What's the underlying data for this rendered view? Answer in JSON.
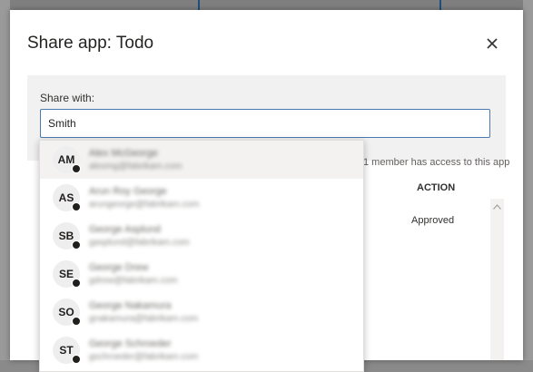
{
  "dialog": {
    "title": "Share app: Todo",
    "close_icon": "close-icon"
  },
  "share": {
    "label": "Share with:",
    "value": "Smith",
    "access_note": "1 member has access to this app"
  },
  "table": {
    "action_header": "ACTION",
    "rows": [
      {
        "action": "Approved"
      }
    ]
  },
  "suggestions": [
    {
      "initials": "AM",
      "name": "Alex McGeorge",
      "email": "alexmg@fabrikam.com"
    },
    {
      "initials": "AS",
      "name": "Arun Roy George",
      "email": "arungeorge@fabrikam.com"
    },
    {
      "initials": "SB",
      "name": "George Asplund",
      "email": "gasplund@fabrikam.com"
    },
    {
      "initials": "SE",
      "name": "George Drew",
      "email": "gdrew@fabrikam.com"
    },
    {
      "initials": "SO",
      "name": "George Nakamura",
      "email": "gnakamura@fabrikam.com"
    },
    {
      "initials": "ST",
      "name": "George Schroeder",
      "email": "gschroeder@fabrikam.com"
    }
  ],
  "colors": {
    "input_border": "#4a7bb0",
    "panel_bg": "#f1f1f1",
    "highlight_bg": "#f3f2f1"
  }
}
